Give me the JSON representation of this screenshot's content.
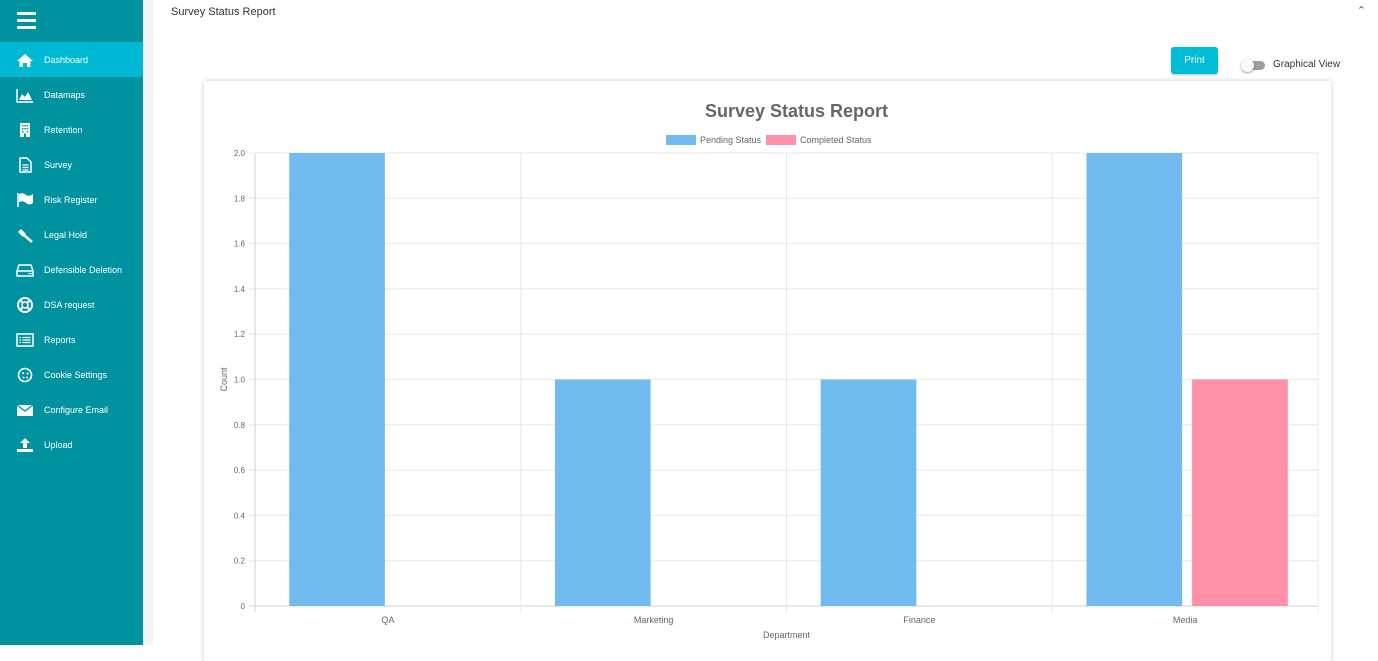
{
  "sidebar": {
    "items": [
      {
        "label": "Dashboard",
        "icon": "home-icon",
        "active": true
      },
      {
        "label": "Datamaps",
        "icon": "area-chart-icon"
      },
      {
        "label": "Retention",
        "icon": "building-icon"
      },
      {
        "label": "Survey",
        "icon": "document-icon"
      },
      {
        "label": "Risk Register",
        "icon": "flag-icon"
      },
      {
        "label": "Legal Hold",
        "icon": "gavel-icon"
      },
      {
        "label": "Defensible Deletion",
        "icon": "hdd-icon"
      },
      {
        "label": "DSA request",
        "icon": "life-ring-icon"
      },
      {
        "label": "Reports",
        "icon": "list-icon"
      },
      {
        "label": "Cookie Settings",
        "icon": "cookie-icon"
      },
      {
        "label": "Configure Email",
        "icon": "envelope-icon"
      },
      {
        "label": "Upload",
        "icon": "upload-icon"
      }
    ]
  },
  "header": {
    "section_title": "Survey Status Report",
    "collapse_glyph": "^",
    "print_label": "Print",
    "toggle_label": "Graphical View",
    "toggle_on": false
  },
  "colors": {
    "sidebar": "#00939f",
    "sidebar_active": "#00b8d4",
    "pending": "#71bbee",
    "completed": "#ff90a8"
  },
  "chart_data": {
    "type": "bar",
    "title": "Survey Status Report",
    "xlabel": "Department",
    "ylabel": "Count",
    "categories": [
      "QA",
      "Marketing",
      "Finance",
      "Media"
    ],
    "series": [
      {
        "name": "Pending Status",
        "values": [
          2,
          1,
          1,
          2
        ]
      },
      {
        "name": "Completed Status",
        "values": [
          0,
          0,
          0,
          1
        ]
      }
    ],
    "ylim": [
      0,
      2
    ],
    "yticks": [
      "0",
      "0.2",
      "0.4",
      "0.6",
      "0.8",
      "1.0",
      "1.2",
      "1.4",
      "1.6",
      "1.8",
      "2.0"
    ],
    "grid": true,
    "legend": "top-center"
  }
}
